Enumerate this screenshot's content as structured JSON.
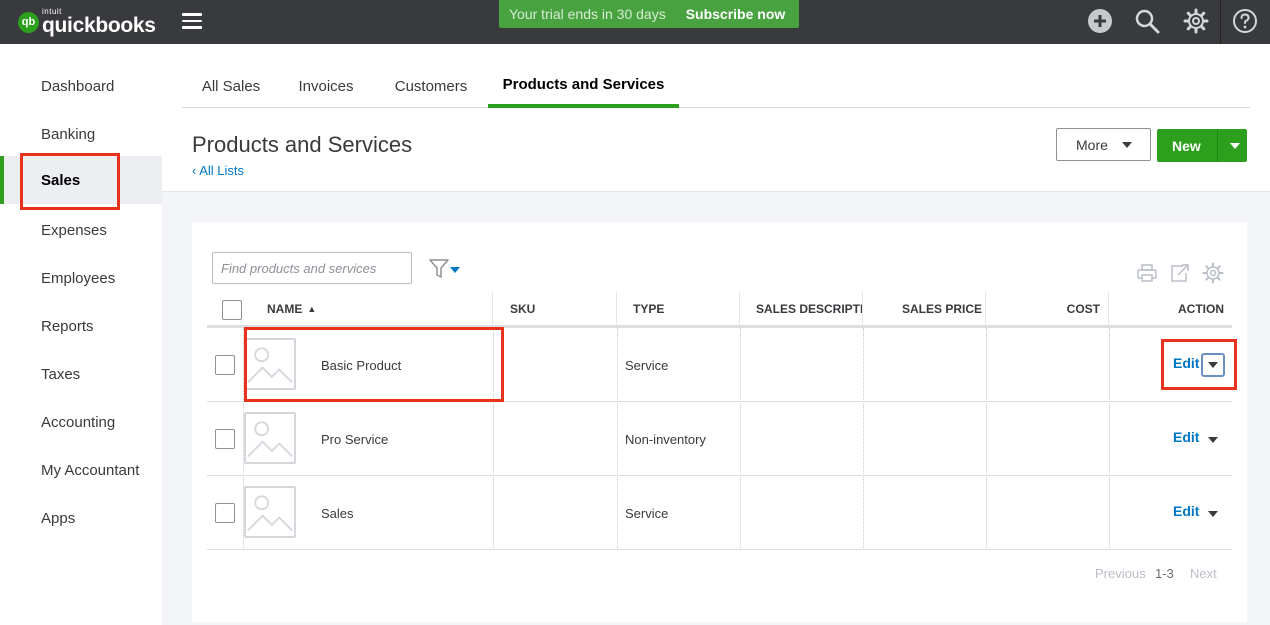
{
  "header": {
    "logo_intuit": "intuit",
    "logo_name": "quickbooks",
    "logo_mark": "qb",
    "trial_text": "Your trial ends in 30 days",
    "trial_cta": "Subscribe now",
    "icons": [
      "hamburger-icon",
      "plus-icon",
      "search-icon",
      "gear-icon",
      "help-icon"
    ]
  },
  "sidebar": {
    "items": [
      {
        "label": "Dashboard"
      },
      {
        "label": "Banking"
      },
      {
        "label": "Sales"
      },
      {
        "label": "Expenses"
      },
      {
        "label": "Employees"
      },
      {
        "label": "Reports"
      },
      {
        "label": "Taxes"
      },
      {
        "label": "Accounting"
      },
      {
        "label": "My Accountant"
      },
      {
        "label": "Apps"
      }
    ],
    "active": "Sales"
  },
  "tabs": [
    {
      "label": "All Sales"
    },
    {
      "label": "Invoices"
    },
    {
      "label": "Customers"
    },
    {
      "label": "Products and Services"
    }
  ],
  "page": {
    "title": "Products and Services",
    "back_link": "All Lists",
    "more_label": "More",
    "new_label": "New"
  },
  "search": {
    "placeholder": "Find products and services"
  },
  "table": {
    "columns": [
      "NAME",
      "SKU",
      "TYPE",
      "SALES DESCRIPTION",
      "SALES PRICE",
      "COST",
      "ACTION"
    ],
    "sort_column": "NAME",
    "sort_direction": "ascending",
    "rows": [
      {
        "name": "Basic Product",
        "sku": "",
        "type": "Service",
        "description": "",
        "price": "",
        "cost": "",
        "action": "Edit"
      },
      {
        "name": "Pro Service",
        "sku": "",
        "type": "Non-inventory",
        "description": "",
        "price": "",
        "cost": "",
        "action": "Edit"
      },
      {
        "name": "Sales",
        "sku": "",
        "type": "Service",
        "description": "",
        "price": "",
        "cost": "",
        "action": "Edit"
      }
    ]
  },
  "pagination": {
    "previous": "Previous",
    "range": "1-3",
    "next": "Next"
  },
  "colors": {
    "brand_green": "#2ca01c",
    "link_blue": "#0077c5",
    "topbar": "#393a3d",
    "highlight_red": "#e8321c"
  }
}
